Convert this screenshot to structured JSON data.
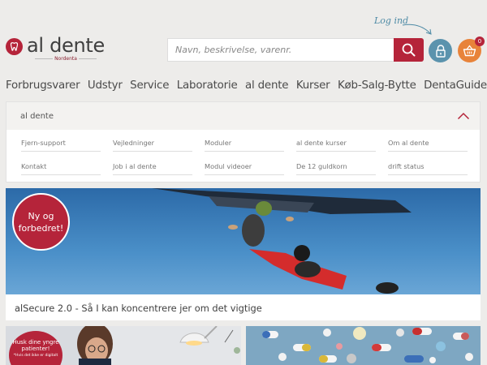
{
  "header": {
    "brand_name": "al dente",
    "brand_sub": "Nordenta",
    "search": {
      "placeholder": "Navn, beskrivelse, varenr."
    },
    "login_hint": "Log ind",
    "cart_count": "0"
  },
  "nav": {
    "items": [
      "Forbrugsvarer",
      "Udstyr",
      "Service",
      "Laboratorie",
      "al dente",
      "Kurser",
      "Køb-Salg-Bytte",
      "DentaGuiden"
    ]
  },
  "dropdown": {
    "title": "al dente",
    "links": [
      "Fjern-support",
      "Vejledninger",
      "Moduler",
      "al dente kurser",
      "Om al dente",
      "Kontakt",
      "Job i al dente",
      "Modul videoer",
      "De 12 guldkorn",
      "drift status"
    ]
  },
  "hero": {
    "badge_line1": "Ny og",
    "badge_line2": "forbedret!",
    "caption": "alSecure 2.0 - Så I kan koncentrere jer om det vigtige"
  },
  "cards": {
    "card1_badge_line1": "Husk dine yngre",
    "card1_badge_line2": "patienter!",
    "card1_badge_line3": "*Hvis det ikke er digitalt"
  },
  "colors": {
    "brand_red": "#b5243a",
    "login_blue": "#5b93ad",
    "cart_orange": "#e8833a",
    "background": "#edecea"
  }
}
